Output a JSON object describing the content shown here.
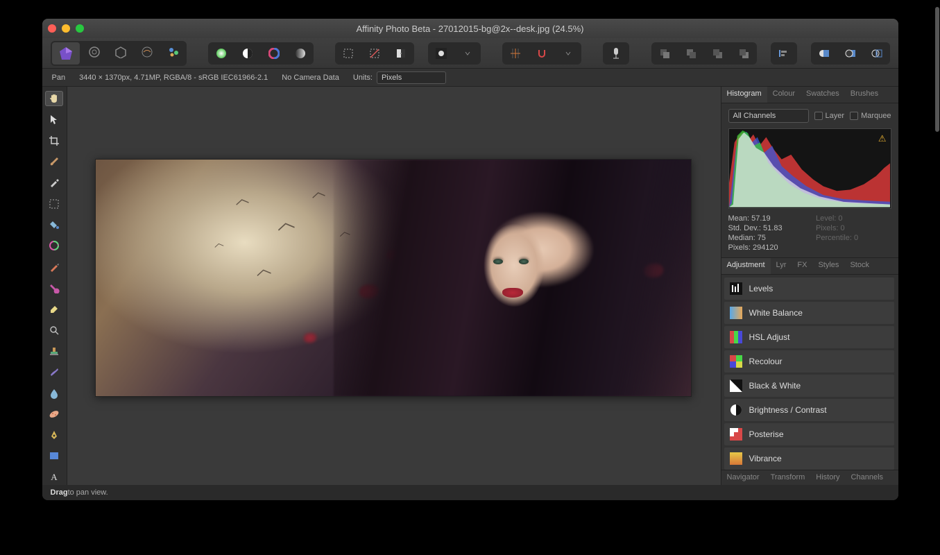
{
  "window": {
    "title": "Affinity Photo Beta - 27012015-bg@2x--desk.jpg (24.5%)"
  },
  "infobar": {
    "tool": "Pan",
    "imageinfo": "3440 × 1370px, 4.71MP, RGBA/8 - sRGB IEC61966-2.1",
    "camera": "No Camera Data",
    "units_label": "Units:",
    "units_value": "Pixels"
  },
  "panels": {
    "top_tabs": [
      "Histogram",
      "Colour",
      "Swatches",
      "Brushes"
    ],
    "top_active": 0,
    "histogram": {
      "channel": "All Channels",
      "layer_label": "Layer",
      "marquee_label": "Marquee",
      "stats": {
        "mean": "Mean: 57.19",
        "stddev": "Std. Dev.: 51.83",
        "median": "Median: 75",
        "pixels": "Pixels: 294120",
        "level": "Level: 0",
        "pixels2": "Pixels: 0",
        "percentile": "Percentile: 0"
      }
    },
    "mid_tabs": [
      "Adjustment",
      "Lyr",
      "FX",
      "Styles",
      "Stock"
    ],
    "mid_active": 0,
    "adjustments": [
      {
        "name": "Levels"
      },
      {
        "name": "White Balance"
      },
      {
        "name": "HSL Adjust"
      },
      {
        "name": "Recolour"
      },
      {
        "name": "Black & White"
      },
      {
        "name": "Brightness / Contrast"
      },
      {
        "name": "Posterise"
      },
      {
        "name": "Vibrance"
      }
    ],
    "bottom_tabs": [
      "Navigator",
      "Transform",
      "History",
      "Channels"
    ]
  },
  "status": {
    "action": "Drag",
    "hint": " to pan view."
  }
}
